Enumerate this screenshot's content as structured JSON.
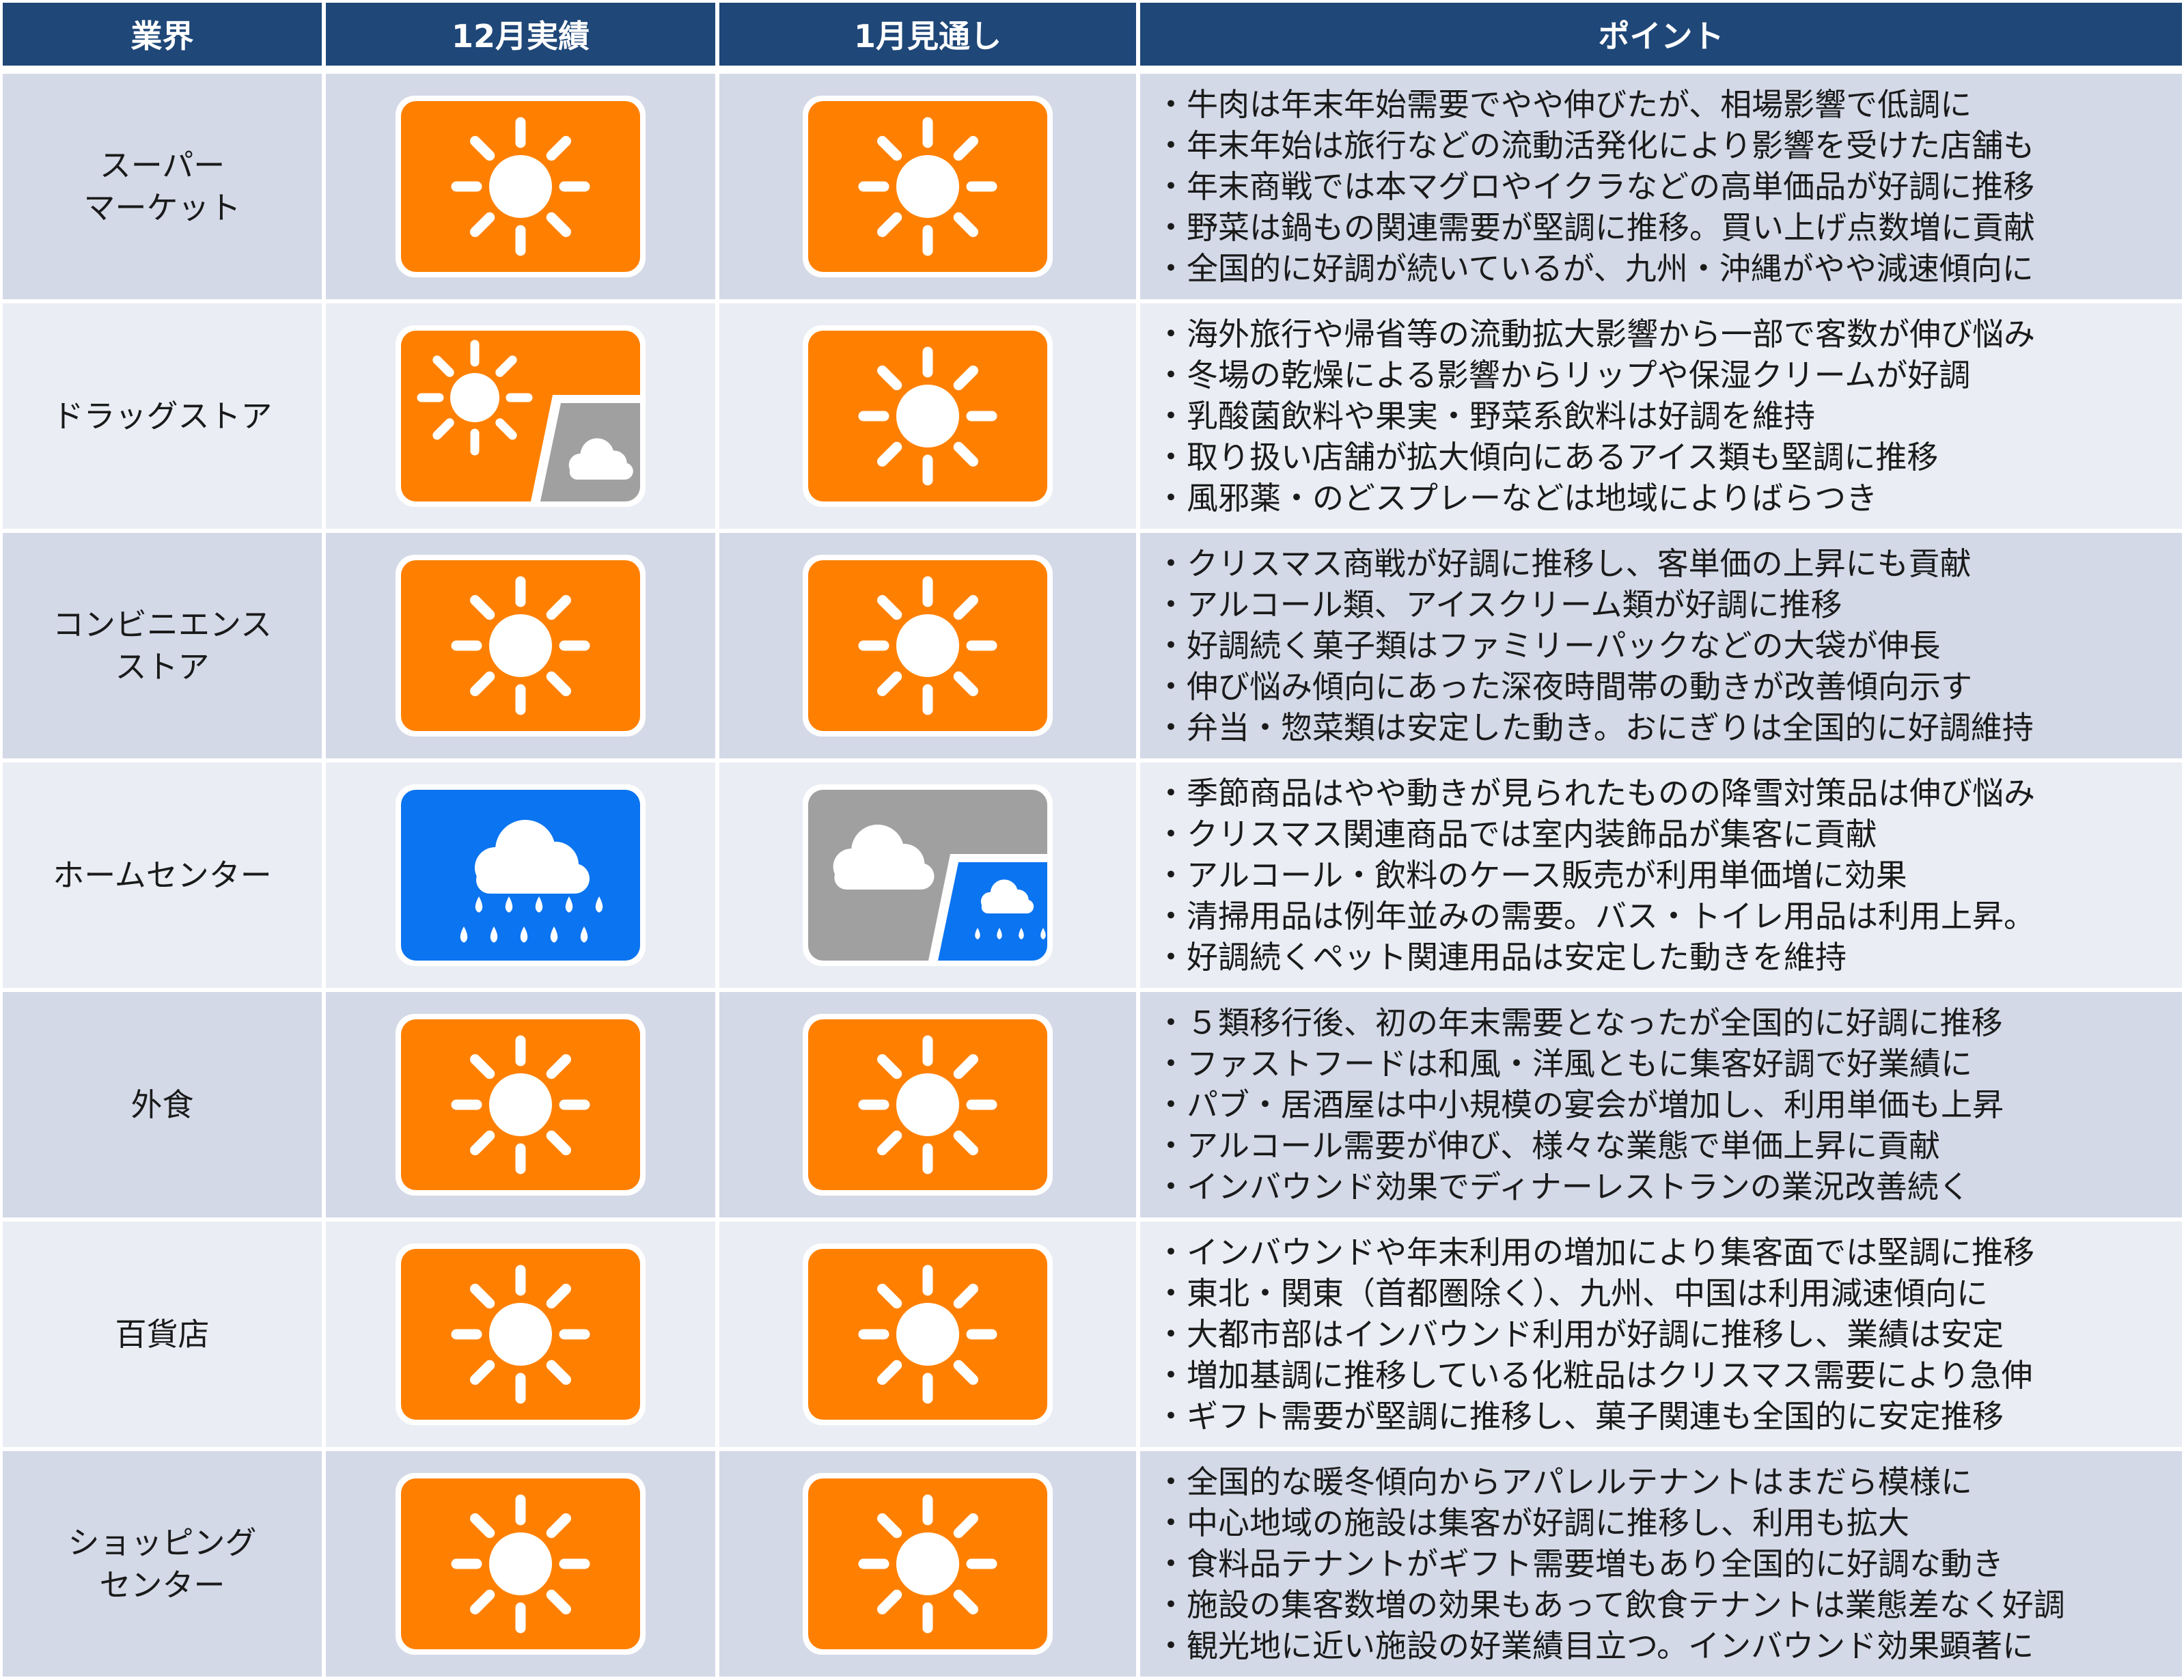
{
  "headers": [
    "業界",
    "12月実績",
    "1月見通し",
    "ポイント"
  ],
  "colors": {
    "header_bg": "#1f4778",
    "row_odd": "#d3d9e7",
    "row_even": "#eaedf4",
    "sunny": "#ff8000",
    "cloudy": "#a0a0a0",
    "rainy": "#0b74f0"
  },
  "rows": [
    {
      "industry": "スーパー\nマーケット",
      "december": "sunny-icon",
      "january": "sunny-icon",
      "points": [
        "・牛肉は年末年始需要でやや伸びたが、相場影響で低調に",
        "・年末年始は旅行などの流動活発化により影響を受けた店舗も",
        "・年末商戦では本マグロやイクラなどの高単価品が好調に推移",
        "・野菜は鍋もの関連需要が堅調に推移。買い上げ点数増に貢献",
        "・全国的に好調が続いているが、九州・沖縄がやや減速傾向に"
      ]
    },
    {
      "industry": "ドラッグストア",
      "december": "sunny-then-cloudy-icon",
      "january": "sunny-icon",
      "points": [
        "・海外旅行や帰省等の流動拡大影響から一部で客数が伸び悩み",
        "・冬場の乾燥による影響からリップや保湿クリームが好調",
        "・乳酸菌飲料や果実・野菜系飲料は好調を維持",
        "・取り扱い店舗が拡大傾向にあるアイス類も堅調に推移",
        "・風邪薬・のどスプレーなどは地域によりばらつき"
      ]
    },
    {
      "industry": "コンビニエンス\nストア",
      "december": "sunny-icon",
      "january": "sunny-icon",
      "points": [
        "・クリスマス商戦が好調に推移し、客単価の上昇にも貢献",
        "・アルコール類、アイスクリーム類が好調に推移",
        "・好調続く菓子類はファミリーパックなどの大袋が伸長",
        "・伸び悩み傾向にあった深夜時間帯の動きが改善傾向示す",
        "・弁当・惣菜類は安定した動き。おにぎりは全国的に好調維持"
      ]
    },
    {
      "industry": "ホームセンター",
      "december": "rainy-icon",
      "january": "cloudy-then-rainy-icon",
      "points": [
        "・季節商品はやや動きが見られたものの降雪対策品は伸び悩み",
        "・クリスマス関連商品では室内装飾品が集客に貢献",
        "・アルコール・飲料のケース販売が利用単価増に効果",
        "・清掃用品は例年並みの需要。バス・トイレ用品は利用上昇。",
        "・好調続くペット関連用品は安定した動きを維持"
      ]
    },
    {
      "industry": "外食",
      "december": "sunny-icon",
      "january": "sunny-icon",
      "points": [
        "・５類移行後、初の年末需要となったが全国的に好調に推移",
        "・ファストフードは和風・洋風ともに集客好調で好業績に",
        "・パブ・居酒屋は中小規模の宴会が増加し、利用単価も上昇",
        "・アルコール需要が伸び、様々な業態で単価上昇に貢献",
        "・インバウンド効果でディナーレストランの業況改善続く"
      ]
    },
    {
      "industry": "百貨店",
      "december": "sunny-icon",
      "january": "sunny-icon",
      "points": [
        "・インバウンドや年末利用の増加により集客面では堅調に推移",
        "・東北・関東（首都圏除く）、九州、中国は利用減速傾向に",
        "・大都市部はインバウンド利用が好調に推移し、業績は安定",
        "・増加基調に推移している化粧品はクリスマス需要により急伸",
        "・ギフト需要が堅調に推移し、菓子関連も全国的に安定推移"
      ]
    },
    {
      "industry": "ショッピング\nセンター",
      "december": "sunny-icon",
      "january": "sunny-icon",
      "points": [
        "・全国的な暖冬傾向からアパレルテナントはまだら模様に",
        "・中心地域の施設は集客が好調に推移し、利用も拡大",
        "・食料品テナントがギフト需要増もあり全国的に好調な動き",
        "・施設の集客数増の効果もあって飲食テナントは業態差なく好調",
        "・観光地に近い施設の好業績目立つ。インバウンド効果顕著に"
      ]
    }
  ]
}
